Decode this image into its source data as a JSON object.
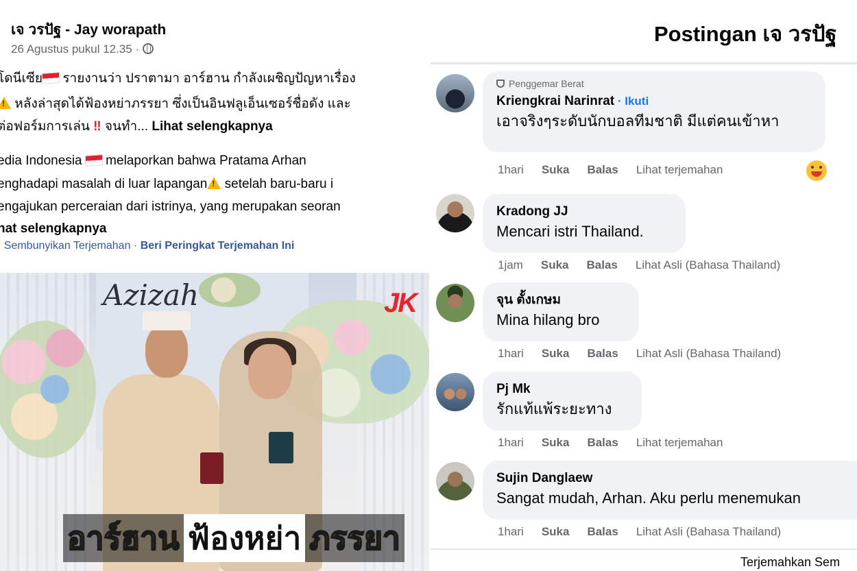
{
  "post": {
    "author": "เจ วรปัฐ - Jay worapath",
    "date": "26 Agustus pukul 12.35 ·",
    "thai_line1": "โดนีเซีย",
    "thai_line1b": " รายงานว่า ปราตามา อาร์ฮาน กำลังเผชิญปัญหาเรื่อง",
    "thai_line2": " หลังล่าสุดได้ฟ้องหย่าภรรยา ซึ่งเป็นอินฟลูเอ็นเซอร์ชื่อดัง และ",
    "thai_line3a": "ต่อฟอร์มการเล่น",
    "thai_line3b": " จนทำ... ",
    "see_more": "Lihat selengkapnya",
    "indo_line1a": "edia Indonesia ",
    "indo_line1b": " melaporkan bahwa Pratama Arhan",
    "indo_line2a": "enghadapi masalah di luar lapangan",
    "indo_line2b": " setelah baru-baru i",
    "indo_line3": "engajukan perceraian dari istrinya, yang merupakan seoran",
    "indo_line4": "hat selengkapnya",
    "hide_translation": "· Sembunyikan Terjemahan · ",
    "rate_translation": "Beri Peringkat Terjemahan Ini",
    "photo": {
      "script_text": "Azizah",
      "logo_text": "JK",
      "caption_1": "อาร์ฮาน",
      "caption_2": "ฟ้องหย่า",
      "caption_3": "ภรรยา"
    }
  },
  "comments_panel": {
    "title": "Postingan เจ วรปัฐ",
    "footer": "Terjemahkan Sem",
    "comments": [
      {
        "badge": "Penggemar Berat",
        "name": "Kriengkrai Narinrat",
        "follow": " · Ikuti",
        "text": "เอาจริงๆระดับนักบอลทีมชาติ มีแต่คนเข้าหา",
        "time": "1hari",
        "like": "Suka",
        "reply": "Balas",
        "extra": "Lihat terjemahan"
      },
      {
        "name": "Kradong JJ",
        "text": "Mencari istri Thailand.",
        "time": "1jam",
        "like": "Suka",
        "reply": "Balas",
        "extra": "Lihat Asli (Bahasa Thailand)"
      },
      {
        "name": "จุน ตั้งเกษม",
        "text": "Mina hilang bro",
        "time": "1hari",
        "like": "Suka",
        "reply": "Balas",
        "extra": "Lihat Asli (Bahasa Thailand)"
      },
      {
        "name": "Pj Mk",
        "text": "รักแท้แพ้ระยะทาง",
        "time": "1hari",
        "like": "Suka",
        "reply": "Balas",
        "extra": "Lihat terjemahan"
      },
      {
        "name": "Sujin Danglaew",
        "text": "Sangat mudah, Arhan. Aku perlu menemukan",
        "time": "1hari",
        "like": "Suka",
        "reply": "Balas",
        "extra": "Lihat Asli (Bahasa Thailand)"
      }
    ]
  },
  "icons": {
    "globe": "globe-icon",
    "flag": "indonesia-flag-icon",
    "warning": "warning-icon",
    "double_exclamation": "double-exclamation-icon",
    "badge": "shield-badge-icon",
    "reaction": "laughing-emoji-icon"
  }
}
